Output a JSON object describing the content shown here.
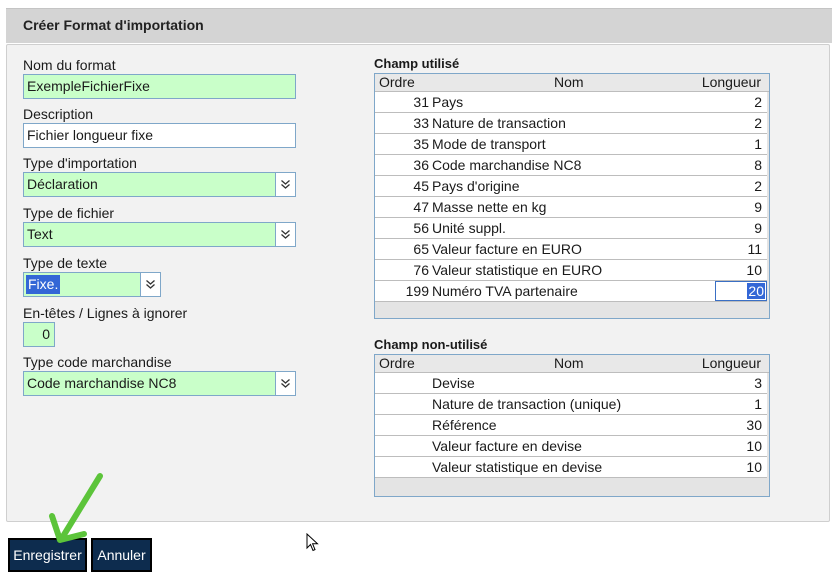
{
  "header": {
    "title": "Créer Format d'importation"
  },
  "form": {
    "nom_label": "Nom du format",
    "nom_value": "ExempleFichierFixe",
    "description_label": "Description",
    "description_value": "Fichier longueur fixe",
    "type_import_label": "Type d'importation",
    "type_import_value": "Déclaration",
    "type_fichier_label": "Type de fichier",
    "type_fichier_value": "Text",
    "type_texte_label": "Type de texte",
    "type_texte_value": "Fixe.",
    "entetes_label": "En-têtes / Lignes à ignorer",
    "entetes_value": "0",
    "code_label": "Type code marchandise",
    "code_value": "Code marchandise NC8"
  },
  "used": {
    "title": "Champ utilisé",
    "headers": {
      "ordre": "Ordre",
      "nom": "Nom",
      "longueur": "Longueur"
    },
    "rows": [
      {
        "ordre": "31",
        "nom": "Pays",
        "longueur": "2"
      },
      {
        "ordre": "33",
        "nom": "Nature de transaction",
        "longueur": "2"
      },
      {
        "ordre": "35",
        "nom": "Mode de transport",
        "longueur": "1"
      },
      {
        "ordre": "36",
        "nom": "Code marchandise NC8",
        "longueur": "8"
      },
      {
        "ordre": "45",
        "nom": "Pays d'origine",
        "longueur": "2"
      },
      {
        "ordre": "47",
        "nom": "Masse nette en kg",
        "longueur": "9"
      },
      {
        "ordre": "56",
        "nom": "Unité suppl.",
        "longueur": "9"
      },
      {
        "ordre": "65",
        "nom": "Valeur facture en EURO",
        "longueur": "11"
      },
      {
        "ordre": "76",
        "nom": "Valeur statistique en EURO",
        "longueur": "10"
      },
      {
        "ordre": "199",
        "nom": "Numéro TVA partenaire",
        "longueur": "20"
      }
    ]
  },
  "unused": {
    "title": "Champ non-utilisé",
    "headers": {
      "ordre": "Ordre",
      "nom": "Nom",
      "longueur": "Longueur"
    },
    "rows": [
      {
        "ordre": "",
        "nom": "Devise",
        "longueur": "3"
      },
      {
        "ordre": "",
        "nom": "Nature de transaction (unique)",
        "longueur": "1"
      },
      {
        "ordre": "",
        "nom": "Référence",
        "longueur": "30"
      },
      {
        "ordre": "",
        "nom": "Valeur facture en devise",
        "longueur": "10"
      },
      {
        "ordre": "",
        "nom": "Valeur statistique en devise",
        "longueur": "10"
      }
    ]
  },
  "buttons": {
    "save": "Enregistrer",
    "cancel": "Annuler"
  },
  "colors": {
    "field_green": "#c9ffc9",
    "field_border": "#7fa7c9",
    "button_bg": "#0d2c4e",
    "selection_blue": "#3367d6",
    "annotation_arrow": "#5cc43a"
  },
  "icons": {
    "dropdown": "chevron-double-down-icon",
    "cursor": "mouse-pointer-icon",
    "annotation": "green-arrow-icon"
  }
}
